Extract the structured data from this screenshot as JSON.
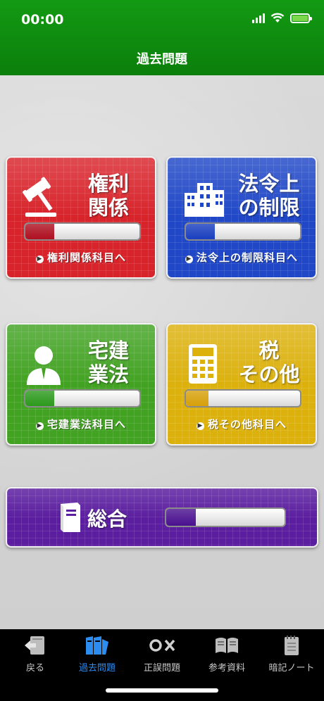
{
  "status_bar": {
    "time": "00:00"
  },
  "header": {
    "title": "過去問題"
  },
  "cards": [
    {
      "title_line1": "権利",
      "title_line2": "関係",
      "link": "権利関係科目へ",
      "progress": 0.25,
      "icon": "gavel-icon",
      "bar_color": "#b01020"
    },
    {
      "title_line1": "法令上",
      "title_line2": "の制限",
      "link": "法令上の制限科目へ",
      "progress": 0.25,
      "icon": "buildings-icon",
      "bar_color": "#1a3fc0"
    },
    {
      "title_line1": "宅建",
      "title_line2": "業法",
      "link": "宅建業法科目へ",
      "progress": 0.25,
      "icon": "person-icon",
      "bar_color": "#2c9a1c"
    },
    {
      "title_line1": "税",
      "title_line2": "その他",
      "link": "税その他科目へ",
      "progress": 0.2,
      "icon": "calculator-icon",
      "bar_color": "#d8a10a"
    }
  ],
  "sogo": {
    "title": "総合",
    "progress": 0.25,
    "icon": "book-icon",
    "bar_color": "#4a1090"
  },
  "tabs": [
    {
      "label": "戻る",
      "icon": "back-icon",
      "active": false
    },
    {
      "label": "過去問題",
      "icon": "books-icon",
      "active": true
    },
    {
      "label": "正誤問題",
      "icon": "ox-icon",
      "active": false
    },
    {
      "label": "参考資料",
      "icon": "open-book-icon",
      "active": false
    },
    {
      "label": "暗記ノート",
      "icon": "notebook-icon",
      "active": false
    }
  ],
  "colors": {
    "header_green": "#119011",
    "tab_active": "#2c8cf0"
  }
}
